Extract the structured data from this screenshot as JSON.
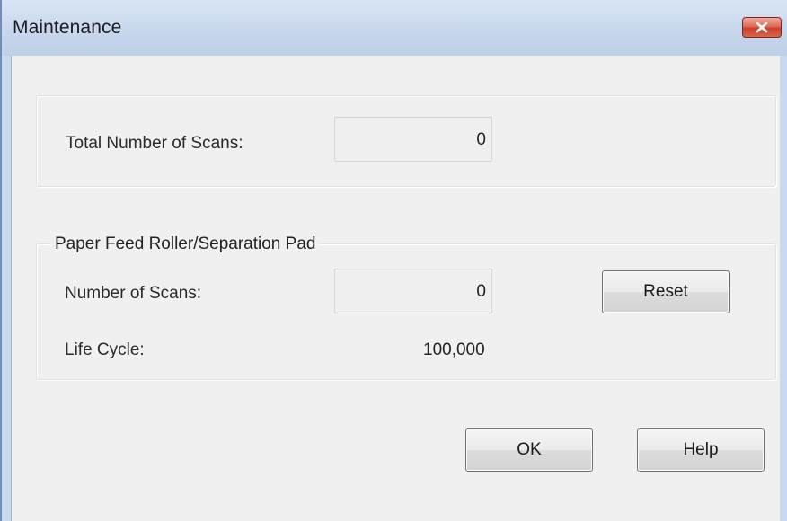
{
  "window": {
    "title": "Maintenance",
    "close_icon": "close-icon"
  },
  "total_scans": {
    "label": "Total Number of Scans:",
    "value": "0"
  },
  "roller_group": {
    "caption": "Paper Feed Roller/Separation Pad",
    "scans_label": "Number of Scans:",
    "scans_value": "0",
    "reset_label": "Reset",
    "life_cycle_label": "Life Cycle:",
    "life_cycle_value": "100,000"
  },
  "buttons": {
    "ok_label": "OK",
    "help_label": "Help"
  },
  "colors": {
    "titlebar": "#c9d9ee",
    "client_bg": "#f0f0f0",
    "close_red": "#c9412c"
  }
}
